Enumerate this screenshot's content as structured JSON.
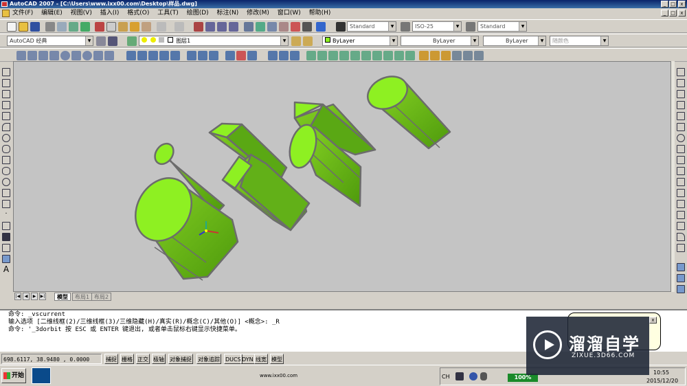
{
  "window": {
    "title": "AutoCAD 2007 - [C:\\Users\\www.ixx00.com\\Desktop\\样品.dwg]",
    "controls": [
      "_",
      "□",
      "x"
    ]
  },
  "menu": [
    "文件(F)",
    "编辑(E)",
    "视图(V)",
    "插入(I)",
    "格式(O)",
    "工具(T)",
    "绘图(D)",
    "标注(N)",
    "修改(M)",
    "窗口(W)",
    "帮助(H)"
  ],
  "toolbar": {
    "text_style": "Standard",
    "dim_style": "ISO-25",
    "table_style": "Standard",
    "workspace": "AutoCAD 经典",
    "layer": "图层1",
    "color": "ByLayer",
    "linetype": "ByLayer",
    "lineweight": "ByLayer",
    "plot_style": "随颜色"
  },
  "layout_tabs": {
    "model": "模型",
    "layout1": "布局1",
    "layout2": "布局2"
  },
  "command_lines": [
    "命令:  _vscurrent",
    "输入选项 [二维线框(2)/三维线框(3)/三维隐藏(H)/真实(R)/概念(C)/其他(O)] <概念>: _R",
    "命令: '_3dorbit 按 ESC 或 ENTER 键退出, 或者单击鼠标右键显示快捷菜单。"
  ],
  "status": {
    "coordinates": "698.6117,  38.9480   , 0.0000",
    "toggles": [
      "捕捉",
      "栅格",
      "正交",
      "极轴",
      "对象捕捉",
      "对象追踪",
      "DUCS",
      "DYN",
      "线宽",
      "模型"
    ]
  },
  "taskbar": {
    "start": "开始",
    "url": "www.ixx00.com",
    "ime": "CH",
    "battery": "100%",
    "time": "10:55",
    "date": "2015/12/20"
  },
  "watermark": {
    "title": "溜溜自学",
    "url": "ZIXUE.3D66.COM"
  },
  "colors": {
    "viewport_bg": "#c4c4c4",
    "solid_fill": "#76c21a",
    "solid_face": "#8ef022",
    "edge": "#6c6c6c"
  }
}
